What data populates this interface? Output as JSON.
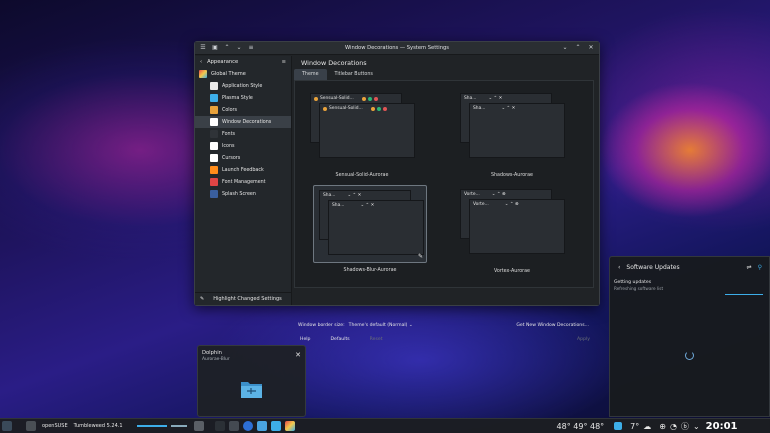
{
  "window": {
    "title": "Window Decorations — System Settings",
    "sidebar_header": "Appearance",
    "global_theme": "Global Theme",
    "items": [
      {
        "label": "Application Style",
        "color": "#e9e9e9"
      },
      {
        "label": "Plasma Style",
        "color": "#3daee9"
      },
      {
        "label": "Colors",
        "color": "#e8a23b"
      },
      {
        "label": "Window Decorations",
        "color": "#ffffff"
      },
      {
        "label": "Fonts",
        "color": "#2f3338"
      },
      {
        "label": "Icons",
        "color": "#ffffff"
      },
      {
        "label": "Cursors",
        "color": "#ffffff"
      },
      {
        "label": "Launch Feedback",
        "color": "#ff8c1a"
      },
      {
        "label": "Font Management",
        "color": "#e04545"
      },
      {
        "label": "Splash Screen",
        "color": "#3a5f9e"
      }
    ],
    "footer_label": "Highlight Changed Settings",
    "content_title": "Window Decorations",
    "tabs": [
      "Theme",
      "Titlebar Buttons"
    ],
    "cards": [
      {
        "name": "Sensual-Solid-Aurorae",
        "back_title": "Sensual-Solid...",
        "front_title": "Sensual-Solid..."
      },
      {
        "name": "Shadows-Aurorae",
        "back_title": "Sha...",
        "front_title": "Sha..."
      },
      {
        "name": "Shadows-Blur-Aurorae",
        "back_title": "Sha...",
        "front_title": "Sha..."
      },
      {
        "name": "Vortex-Aurorae",
        "back_title": "Vorte...",
        "front_title": "Vorte..."
      }
    ],
    "border_size_label": "Window border size:",
    "border_size_value": "Theme's default (Normal)",
    "get_new": "Get New Window Decorations...",
    "buttons": {
      "help": "Help",
      "defaults": "Defaults",
      "reset": "Reset",
      "apply": "Apply"
    }
  },
  "updates": {
    "title": "Software Updates",
    "status": "Getting updates",
    "substatus": "Refreshing software list"
  },
  "tooltip": {
    "title": "Dolphin",
    "subtitle": "Aurorae-Blur"
  },
  "taskbar": {
    "distro": "openSUSE",
    "version": "Tumbleweed 5.24.1",
    "temps": "48° 49° 48°",
    "weather": "7°",
    "clock": "20:01"
  },
  "colors": {
    "accent": "#3daee9",
    "window_bg": "#202326"
  }
}
